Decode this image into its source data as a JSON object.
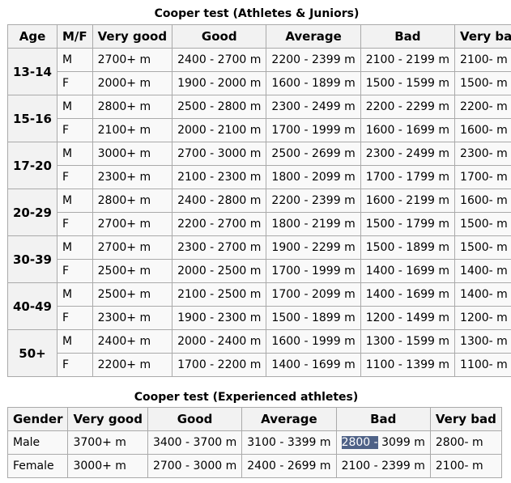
{
  "table1": {
    "caption": "Cooper test (Athletes & Juniors)",
    "headers": [
      "Age",
      "M/F",
      "Very good",
      "Good",
      "Average",
      "Bad",
      "Very bad"
    ],
    "groups": [
      {
        "age": "13-14",
        "rows": [
          {
            "sex": "M",
            "cells": [
              "2700+ m",
              "2400 - 2700 m",
              "2200 - 2399 m",
              "2100 - 2199 m",
              "2100- m"
            ]
          },
          {
            "sex": "F",
            "cells": [
              "2000+ m",
              "1900 - 2000 m",
              "1600 - 1899 m",
              "1500 - 1599 m",
              "1500- m"
            ]
          }
        ]
      },
      {
        "age": "15-16",
        "rows": [
          {
            "sex": "M",
            "cells": [
              "2800+ m",
              "2500 - 2800 m",
              "2300 - 2499 m",
              "2200 - 2299 m",
              "2200- m"
            ]
          },
          {
            "sex": "F",
            "cells": [
              "2100+ m",
              "2000 - 2100 m",
              "1700 - 1999 m",
              "1600 - 1699 m",
              "1600- m"
            ]
          }
        ]
      },
      {
        "age": "17-20",
        "rows": [
          {
            "sex": "M",
            "cells": [
              "3000+ m",
              "2700 - 3000 m",
              "2500 - 2699 m",
              "2300 - 2499 m",
              "2300- m"
            ]
          },
          {
            "sex": "F",
            "cells": [
              "2300+ m",
              "2100 - 2300 m",
              "1800 - 2099 m",
              "1700 - 1799 m",
              "1700- m"
            ]
          }
        ]
      },
      {
        "age": "20-29",
        "rows": [
          {
            "sex": "M",
            "cells": [
              "2800+ m",
              "2400 - 2800 m",
              "2200 - 2399 m",
              "1600 - 2199 m",
              "1600- m"
            ]
          },
          {
            "sex": "F",
            "cells": [
              "2700+ m",
              "2200 - 2700 m",
              "1800 - 2199 m",
              "1500 - 1799 m",
              "1500- m"
            ]
          }
        ]
      },
      {
        "age": "30-39",
        "rows": [
          {
            "sex": "M",
            "cells": [
              "2700+ m",
              "2300 - 2700 m",
              "1900 - 2299 m",
              "1500 - 1899 m",
              "1500- m"
            ]
          },
          {
            "sex": "F",
            "cells": [
              "2500+ m",
              "2000 - 2500 m",
              "1700 - 1999 m",
              "1400 - 1699 m",
              "1400- m"
            ]
          }
        ]
      },
      {
        "age": "40-49",
        "rows": [
          {
            "sex": "M",
            "cells": [
              "2500+ m",
              "2100 - 2500 m",
              "1700 - 2099 m",
              "1400 - 1699 m",
              "1400- m"
            ]
          },
          {
            "sex": "F",
            "cells": [
              "2300+ m",
              "1900 - 2300 m",
              "1500 - 1899 m",
              "1200 - 1499 m",
              "1200- m"
            ]
          }
        ]
      },
      {
        "age": "50+",
        "rows": [
          {
            "sex": "M",
            "cells": [
              "2400+ m",
              "2000 - 2400 m",
              "1600 - 1999 m",
              "1300 - 1599 m",
              "1300- m"
            ]
          },
          {
            "sex": "F",
            "cells": [
              "2200+ m",
              "1700 - 2200 m",
              "1400 - 1699 m",
              "1100 - 1399 m",
              "1100- m"
            ]
          }
        ]
      }
    ]
  },
  "table2": {
    "caption": "Cooper test (Experienced athletes)",
    "headers": [
      "Gender",
      "Very good",
      "Good",
      "Average",
      "Bad",
      "Very bad"
    ],
    "rows": [
      {
        "gender": "Male",
        "very_good": "3700+ m",
        "good": "3400 - 3700 m",
        "average": "3100 - 3399 m",
        "bad_selected": "2800 -",
        "bad_rest": " 3099 m",
        "very_bad": "2800- m"
      },
      {
        "gender": "Female",
        "very_good": "3000+ m",
        "good": "2700 - 3000 m",
        "average": "2400 - 2699 m",
        "bad": "2100 - 2399 m",
        "very_bad": "2100- m"
      }
    ]
  },
  "colors": {
    "selection_bg": "#4f6287",
    "selection_text": "#ffffff",
    "border": "#aaaaaa",
    "header_bg": "#f2f2f2",
    "cell_bg": "#f9f9f9"
  }
}
